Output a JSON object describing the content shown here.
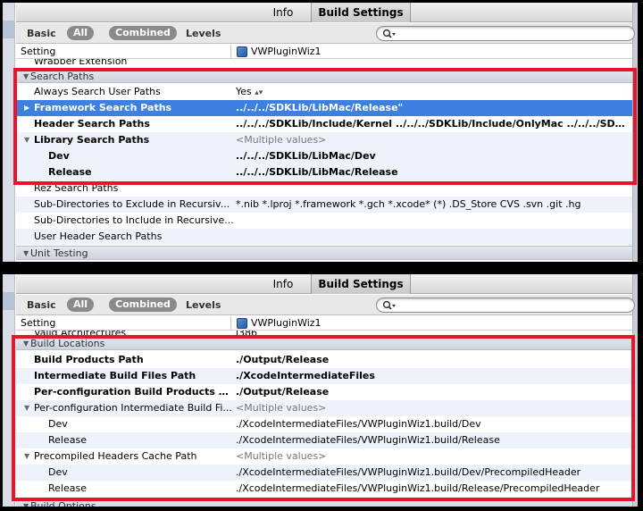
{
  "tabs": {
    "info": "Info",
    "build_settings": "Build Settings"
  },
  "toolbar": {
    "basic": "Basic",
    "all": "All",
    "combined": "Combined",
    "levels": "Levels"
  },
  "columns": {
    "setting": "Setting",
    "project": "VWPluginWiz1"
  },
  "top": {
    "partial_row": "Wrapper Extension",
    "group_search": "Search Paths",
    "always_search": {
      "name": "Always Search User Paths",
      "value": "Yes"
    },
    "framework": {
      "name": "Framework Search Paths",
      "value": "../../../SDKLib/LibMac/Release\""
    },
    "header": {
      "name": "Header Search Paths",
      "value": "../../../SDKLib/Include/Kernel ../../../SDKLib/Include/OnlyMac ../../../SDKLib/I..."
    },
    "library": {
      "name": "Library Search Paths",
      "value": "<Multiple values>"
    },
    "lib_dev": {
      "name": "Dev",
      "value": "../../../SDKLib/LibMac/Dev"
    },
    "lib_release": {
      "name": "Release",
      "value": "../../../SDKLib/LibMac/Release"
    },
    "rez": {
      "name": "Rez Search Paths",
      "value": ""
    },
    "exclude": {
      "name": "Sub-Directories to Exclude in Recursiv...",
      "value": "*.nib *.lproj *.framework *.gch *.xcode* (*) .DS_Store CVS .svn .git .hg"
    },
    "include": {
      "name": "Sub-Directories to Include in Recursive...",
      "value": ""
    },
    "user_header": {
      "name": "User Header Search Paths",
      "value": ""
    },
    "group_unit": "Unit Testing"
  },
  "bottom": {
    "partial_row": "Valid Architectures",
    "partial_value": "i386",
    "group_build": "Build Locations",
    "products": {
      "name": "Build Products Path",
      "value": "./Output/Release"
    },
    "intermediate": {
      "name": "Intermediate Build Files Path",
      "value": "./XcodeIntermediateFiles"
    },
    "per_config_products": {
      "name": "Per-configuration Build Products Path",
      "value": "./Output/Release"
    },
    "per_config_inter": {
      "name": "Per-configuration Intermediate Build Fi...",
      "value": "<Multiple values>"
    },
    "inter_dev": {
      "name": "Dev",
      "value": "./XcodeIntermediateFiles/VWPluginWiz1.build/Dev"
    },
    "inter_release": {
      "name": "Release",
      "value": "./XcodeIntermediateFiles/VWPluginWiz1.build/Release"
    },
    "precompiled": {
      "name": "Precompiled Headers Cache Path",
      "value": "<Multiple values>"
    },
    "pch_dev": {
      "name": "Dev",
      "value": "./XcodeIntermediateFiles/VWPluginWiz1.build/Dev/PrecompiledHeader"
    },
    "pch_release": {
      "name": "Release",
      "value": "./XcodeIntermediateFiles/VWPluginWiz1.build/Release/PrecompiledHeader"
    },
    "group_partial": "Build Options"
  },
  "colors": {
    "highlight": "#e8152a",
    "selection": "#3d80df"
  },
  "icons": {
    "search": "magnifier-with-dropdown",
    "project": "xcode-project-icon",
    "disclosure": "triangle"
  }
}
